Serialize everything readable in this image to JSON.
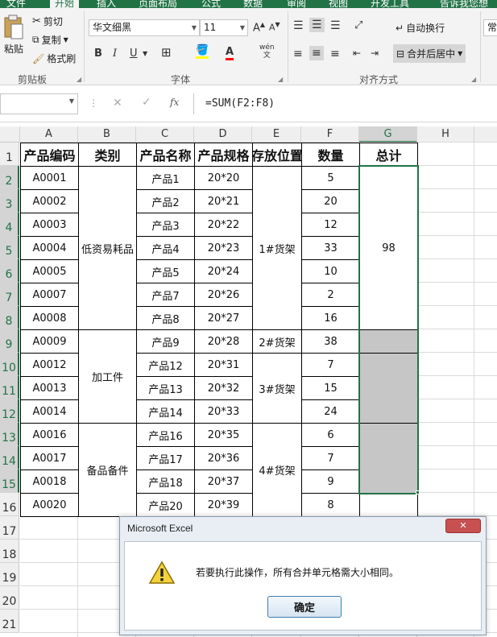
{
  "ribbon": {
    "tabs": [
      "文件",
      "开始",
      "插入",
      "页面布局",
      "公式",
      "数据",
      "审阅",
      "视图",
      "开发工具"
    ],
    "tellme": "告诉我您想",
    "clipboard": {
      "paste": "粘贴",
      "cut": "剪切",
      "copy": "复制",
      "format_painter": "格式刷",
      "label": "剪贴板"
    },
    "font": {
      "name": "华文细黑",
      "size": "11",
      "label": "字体",
      "bold": "B",
      "italic": "I",
      "underline": "U"
    },
    "alignment": {
      "wrap": "自动换行",
      "merge": "合并后居中",
      "label": "对齐方式"
    },
    "number": {
      "format": "常"
    }
  },
  "formula_bar": {
    "fx": "fx",
    "formula": "=SUM(F2:F8)"
  },
  "columns": [
    "A",
    "B",
    "C",
    "D",
    "E",
    "F",
    "G",
    "H"
  ],
  "rows": [
    "1",
    "2",
    "3",
    "4",
    "5",
    "6",
    "7",
    "8",
    "9",
    "10",
    "11",
    "12",
    "13",
    "14",
    "15",
    "16",
    "17",
    "18",
    "19",
    "20",
    "21"
  ],
  "table": {
    "headers": [
      "产品编码",
      "类别",
      "产品名称",
      "产品规格",
      "存放位置",
      "数量",
      "总计"
    ],
    "codes": [
      "A0001",
      "A0002",
      "A0003",
      "A0004",
      "A0005",
      "A0007",
      "A0008",
      "A0009",
      "A0012",
      "A0013",
      "A0014",
      "A0016",
      "A0017",
      "A0018",
      "A0020"
    ],
    "categories": [
      "低资易耗品",
      "加工件",
      "备品备件"
    ],
    "names": [
      "产品1",
      "产品2",
      "产品3",
      "产品4",
      "产品5",
      "产品7",
      "产品8",
      "产品9",
      "产品12",
      "产品13",
      "产品14",
      "产品16",
      "产品17",
      "产品18",
      "产品20"
    ],
    "specs": [
      "20*20",
      "20*21",
      "20*22",
      "20*23",
      "20*24",
      "20*26",
      "20*27",
      "20*28",
      "20*31",
      "20*32",
      "20*33",
      "20*35",
      "20*36",
      "20*37",
      "20*39"
    ],
    "locations": [
      "1#货架",
      "2#货架",
      "3#货架",
      "4#货架"
    ],
    "quantities": [
      "5",
      "20",
      "12",
      "33",
      "10",
      "2",
      "16",
      "38",
      "7",
      "15",
      "24",
      "6",
      "7",
      "9",
      "8"
    ],
    "total": "98"
  },
  "dialog": {
    "title": "Microsoft Excel",
    "message": "若要执行此操作，所有合并单元格需大小相同。",
    "ok": "确定",
    "close": "✕"
  }
}
